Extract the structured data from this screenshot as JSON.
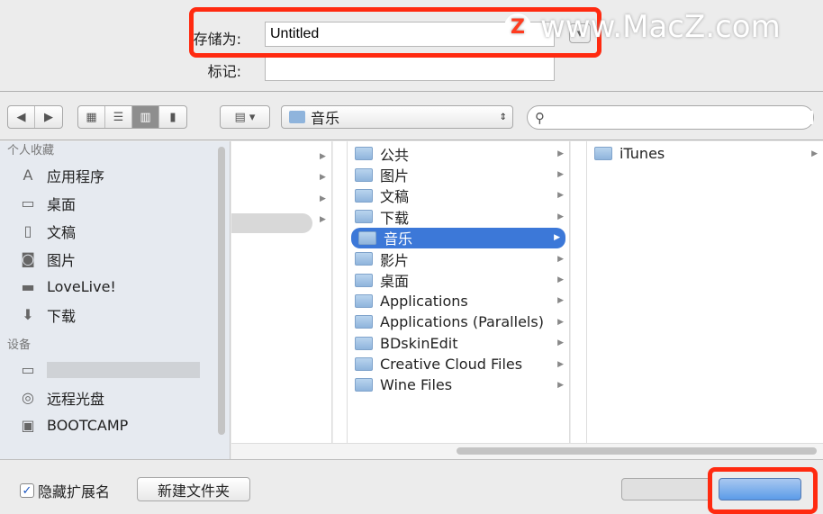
{
  "save": {
    "label": "存储为:",
    "value": "Untitled",
    "tags_label": "标记:",
    "tags_value": ""
  },
  "watermark": "www.MacZ.com",
  "toolbar": {
    "location": "音乐",
    "search_placeholder": ""
  },
  "sidebar": {
    "favorites_header": "个人收藏",
    "favorites": [
      {
        "label": "应用程序",
        "icon": "applications-icon"
      },
      {
        "label": "桌面",
        "icon": "desktop-icon"
      },
      {
        "label": "文稿",
        "icon": "documents-icon"
      },
      {
        "label": "图片",
        "icon": "pictures-icon"
      },
      {
        "label": "LoveLive!",
        "icon": "folder-icon"
      },
      {
        "label": "下载",
        "icon": "downloads-icon"
      }
    ],
    "devices_header": "设备",
    "devices": [
      {
        "label": "",
        "icon": "laptop-icon"
      },
      {
        "label": "远程光盘",
        "icon": "disc-icon"
      },
      {
        "label": "BOOTCAMP",
        "icon": "drive-icon"
      }
    ]
  },
  "columns": {
    "col2": [
      "公共",
      "图片",
      "文稿",
      "下载",
      "音乐",
      "影片",
      "桌面",
      "Applications",
      "Applications (Parallels)",
      "BDskinEdit",
      "Creative Cloud Files",
      "Wine Files"
    ],
    "col2_selected": "音乐",
    "col3": [
      "iTunes"
    ]
  },
  "bottom": {
    "hide_ext_label": "隐藏扩展名",
    "hide_ext_checked": true,
    "new_folder": "新建文件夹"
  },
  "colors": {
    "highlight": "#ff2a10",
    "selection": "#3c78d8"
  }
}
